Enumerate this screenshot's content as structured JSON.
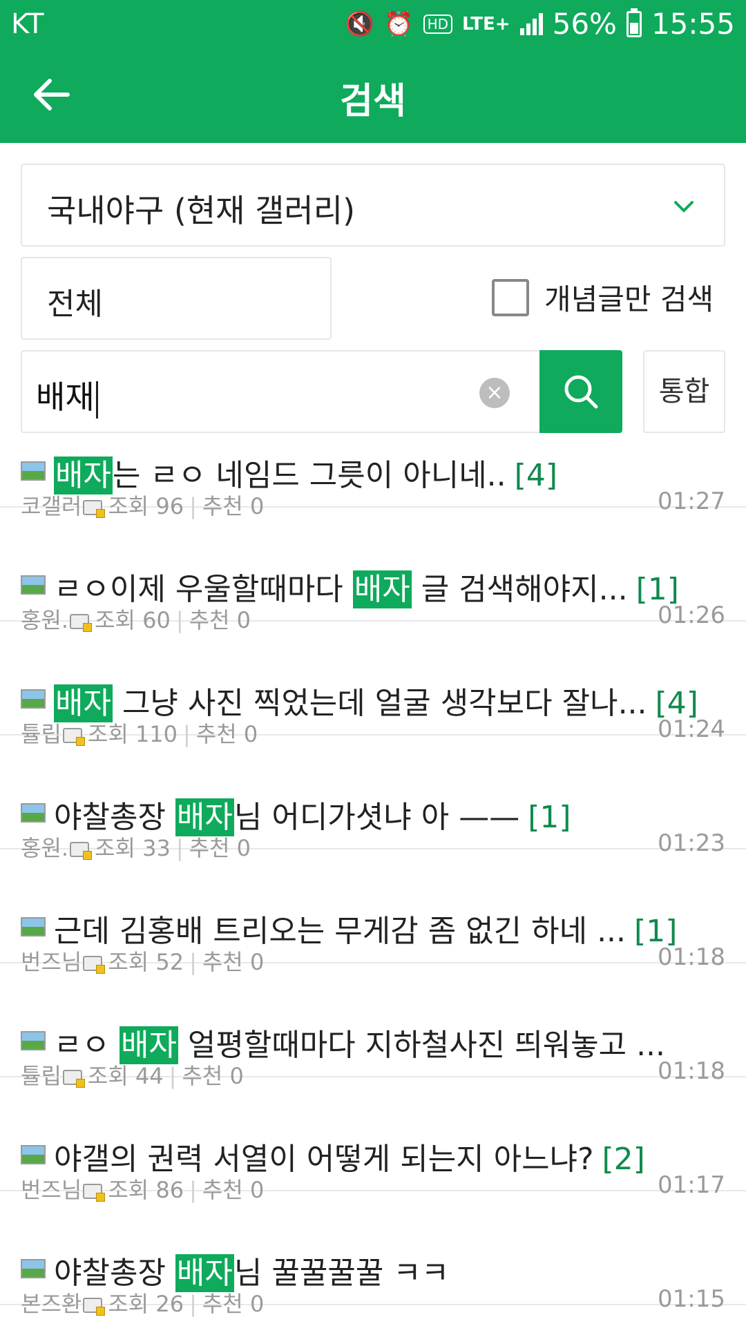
{
  "status_bar": {
    "carrier": "KT",
    "network": "LTE+",
    "hd": "HD",
    "battery": "56%",
    "battery_level": 0.56,
    "time": "15:55"
  },
  "app_bar": {
    "title": "검색",
    "back_icon": "arrow-left-icon"
  },
  "filters": {
    "gallery": "국내야구 (현재 갤러리)",
    "range": "전체",
    "concept_only_label": "개념글만 검색",
    "concept_only_checked": false,
    "query": "배재",
    "unified_label": "통합",
    "search_icon": "search-icon",
    "clear_icon": "clear-icon"
  },
  "colors": {
    "brand": "#0faa5c",
    "count": "#0f8a4c"
  },
  "results": [
    {
      "pre": "",
      "hl": "배자",
      "post": "는 ㄹㅇ 네임드 그릇이 아니네..",
      "count": "[4]",
      "author": "코갤러",
      "views": "조회 96",
      "recs": "추천 0",
      "time": "01:27"
    },
    {
      "pre": "ㄹㅇ이제 우울할때마다 ",
      "hl": "배자",
      "post": " 글 검색해야지...",
      "count": "[1]",
      "author": "홍원.",
      "views": "조회 60",
      "recs": "추천 0",
      "time": "01:26"
    },
    {
      "pre": "",
      "hl": "배자",
      "post": " 그냥 사진 찍었는데 얼굴 생각보다 잘나...",
      "count": "[4]",
      "author": "튤립",
      "views": "조회 110",
      "recs": "추천 0",
      "time": "01:24"
    },
    {
      "pre": "야찰총장 ",
      "hl": "배자",
      "post": "님 어디가셧냐 아 ——",
      "count": "[1]",
      "author": "홍원.",
      "views": "조회 33",
      "recs": "추천 0",
      "time": "01:23"
    },
    {
      "pre": "근데 김홍배 트리오는 무게감 좀 없긴 하네 ...",
      "hl": "",
      "post": "",
      "count": "[1]",
      "author": "번즈님",
      "views": "조회 52",
      "recs": "추천 0",
      "time": "01:18"
    },
    {
      "pre": "ㄹㅇ ",
      "hl": "배자",
      "post": " 얼평할때마다 지하철사진 띄워놓고 ...",
      "count": "",
      "author": "튤립",
      "views": "조회 44",
      "recs": "추천 0",
      "time": "01:18"
    },
    {
      "pre": "야갤의 권력 서열이 어떻게 되는지 아느냐?",
      "hl": "",
      "post": "",
      "count": "[2]",
      "author": "번즈님",
      "views": "조회 86",
      "recs": "추천 0",
      "time": "01:17"
    },
    {
      "pre": "야찰총장 ",
      "hl": "배자",
      "post": "님 꿀꿀꿀꿀 ㅋㅋ",
      "count": "",
      "author": "본즈환",
      "views": "조회 26",
      "recs": "추천 0",
      "time": "01:15"
    }
  ]
}
